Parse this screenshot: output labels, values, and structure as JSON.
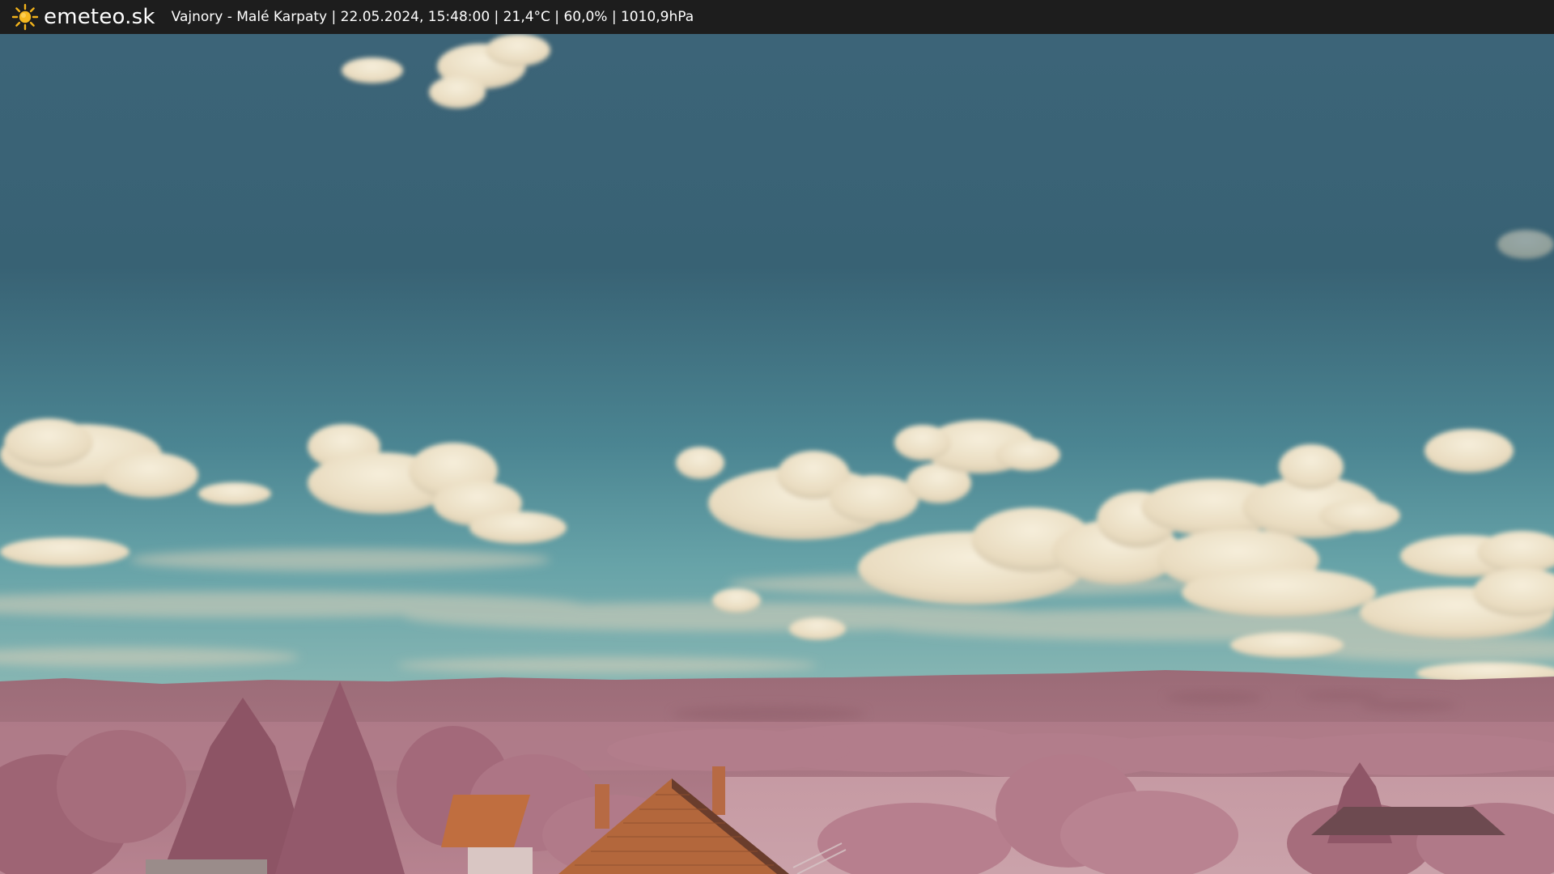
{
  "header": {
    "brand": "emeteo.sk",
    "caption": "Vajnory - Malé Karpaty | 22.05.2024, 15:48:00 | 21,4°C | 60,0% | 1010,9hPa",
    "logo_icon": "sun-icon"
  },
  "colors": {
    "bar_background": "#1d1d1d",
    "sun": "#f2b21b",
    "sky_top": "#355566",
    "sky_bottom": "#5d9da5",
    "cloud": "#efe6cf",
    "vegetation": "#b07888",
    "roof": "#b8673a"
  }
}
